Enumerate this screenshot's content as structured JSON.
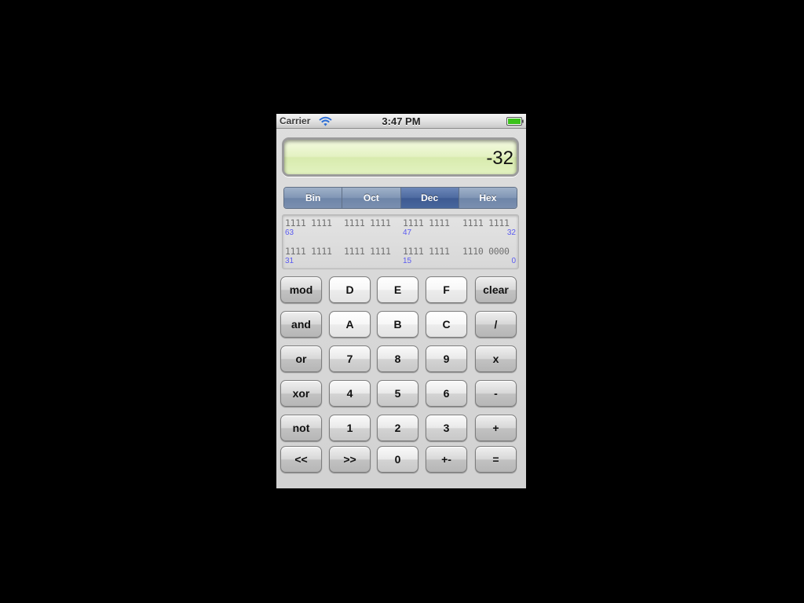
{
  "status_bar": {
    "carrier": "Carrier",
    "time": "3:47 PM",
    "battery_color": "#3cc21b"
  },
  "display": {
    "value": "-32",
    "background_color": "#e4f2c2"
  },
  "base_selector": {
    "options": [
      "Bin",
      "Oct",
      "Dec",
      "Hex"
    ],
    "selected": "Dec"
  },
  "binary": {
    "row1": {
      "groups": [
        "1111 1111",
        "1111 1111",
        "1111 1111",
        "1111 1111"
      ],
      "index_left": "63",
      "index_mid": "47",
      "index_right": "32"
    },
    "row2": {
      "groups": [
        "1111 1111",
        "1111 1111",
        "1111 1111",
        "1110 0000"
      ],
      "index_left": "31",
      "index_mid": "15",
      "index_right": "0"
    },
    "index_color": "#5a5af0"
  },
  "keypad": {
    "rows": [
      [
        "mod",
        "D",
        "E",
        "F",
        "clear"
      ],
      [
        "and",
        "A",
        "B",
        "C",
        "/"
      ],
      [
        "or",
        "7",
        "8",
        "9",
        "x"
      ],
      [
        "xor",
        "4",
        "5",
        "6",
        "-"
      ],
      [
        "not",
        "1",
        "2",
        "3",
        "+"
      ],
      [
        "<<",
        ">>",
        "0",
        "+-",
        "="
      ]
    ]
  }
}
